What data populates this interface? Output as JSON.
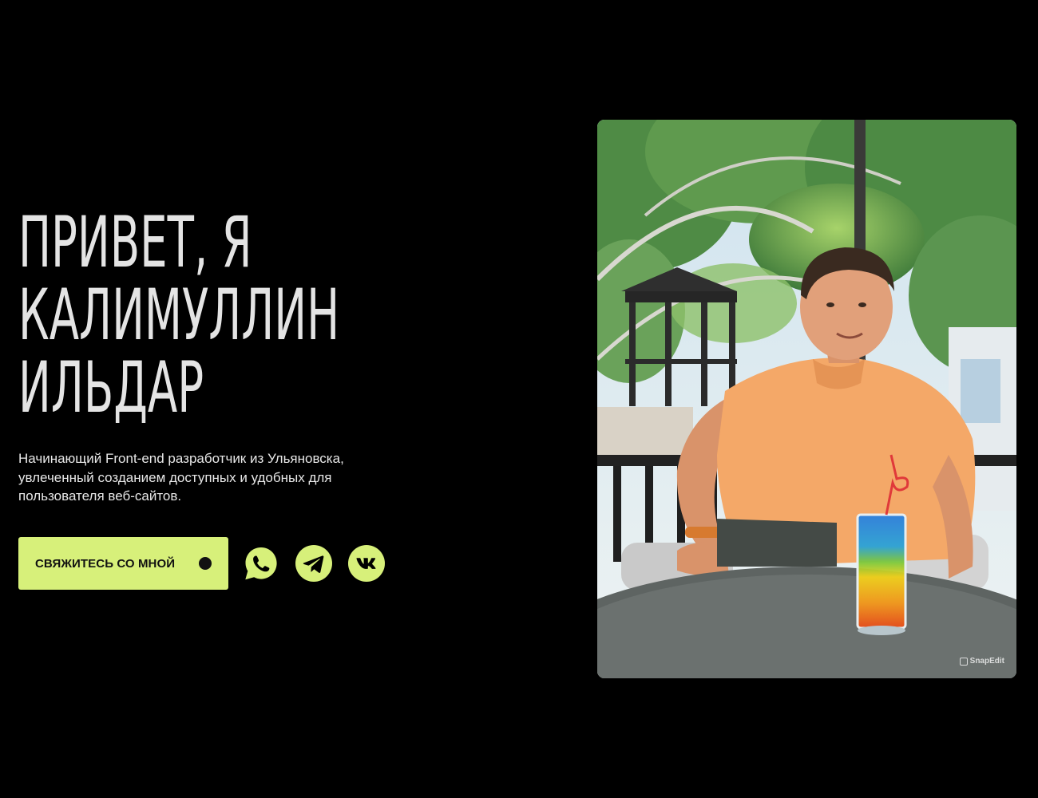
{
  "hero": {
    "title_lines": [
      "ПРИВЕТ, Я",
      "КАЛИМУЛЛИН",
      "ИЛЬДАР"
    ],
    "description": "Начинающий Front-end разработчик из Ульяновска, увлеченный созданием доступных и удобных для пользователя веб-сайтов.",
    "cta_label": "СВЯЖИТЕСЬ СО МНОЙ"
  },
  "social": [
    {
      "name": "whatsapp",
      "icon": "whatsapp-icon"
    },
    {
      "name": "telegram",
      "icon": "telegram-icon"
    },
    {
      "name": "vk",
      "icon": "vk-icon"
    }
  ],
  "photo": {
    "watermark": "SnapEdit"
  },
  "colors": {
    "background": "#000000",
    "accent": "#d7f07a",
    "title": "#e4e4e4",
    "text": "#e8e8e8"
  }
}
